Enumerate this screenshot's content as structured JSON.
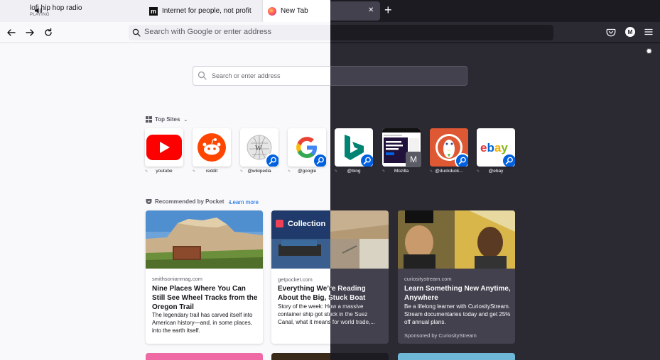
{
  "tabs": [
    {
      "title": "lofi hip hop radio",
      "subtitle": "PLAYING",
      "icon": "speaker-icon"
    },
    {
      "title": "Internet for people, not profit",
      "icon": "m-logo-icon"
    },
    {
      "title": "New Tab",
      "icon": "firefox-icon",
      "active": true
    }
  ],
  "navbar": {
    "url_placeholder": "Search with Google or enter address",
    "account_initial": "M"
  },
  "newtab": {
    "search_placeholder": "Search or enter address",
    "top_sites_heading": "Top Sites",
    "top_sites": [
      {
        "label": "youtube",
        "icon": "youtube-icon"
      },
      {
        "label": "reddit",
        "icon": "reddit-icon"
      },
      {
        "label": "@wikipedia",
        "icon": "wikipedia-icon",
        "search_shortcut": true
      },
      {
        "label": "@google",
        "icon": "google-icon",
        "search_shortcut": true
      },
      {
        "label": "@bing",
        "icon": "bing-icon",
        "search_shortcut": true
      },
      {
        "label": "Mozilla",
        "icon": "mozilla-thumbnail",
        "letter": "M"
      },
      {
        "label": "@duckduck...",
        "icon": "duckduckgo-icon",
        "search_shortcut": true
      },
      {
        "label": "@ebay",
        "icon": "ebay-icon",
        "search_shortcut": true
      }
    ],
    "pocket_heading": "Recommended by Pocket",
    "learn_more": "Learn more",
    "stories": [
      {
        "source": "smithsonianmag.com",
        "title": "Nine Places Where You Can Still See Wheel Tracks from the Oregon Trail",
        "excerpt": "The legendary trail has carved itself into American history—and, in some places, into the earth itself."
      },
      {
        "source": "getpocket.com",
        "collection_label": "Collection",
        "title": "Everything We’re Reading About the Big, Stuck Boat",
        "excerpt": "Story of the week: How a massive container ship got stuck in the Suez Canal, what it means for world trade,..."
      },
      {
        "source": "curiositystream.com",
        "title": "Learn Something New Anytime, Anywhere",
        "excerpt": "Be a lifelong learner with CuriosityStream. Stream documentaries today and get 25% off annual plans.",
        "sponsor": "Sponsored by CuriosityStream"
      }
    ]
  },
  "colors": {
    "light_bg": "#f9f9fb",
    "dark_bg": "#2b2a33",
    "accent": "#0060df",
    "link": "#0061e0"
  }
}
